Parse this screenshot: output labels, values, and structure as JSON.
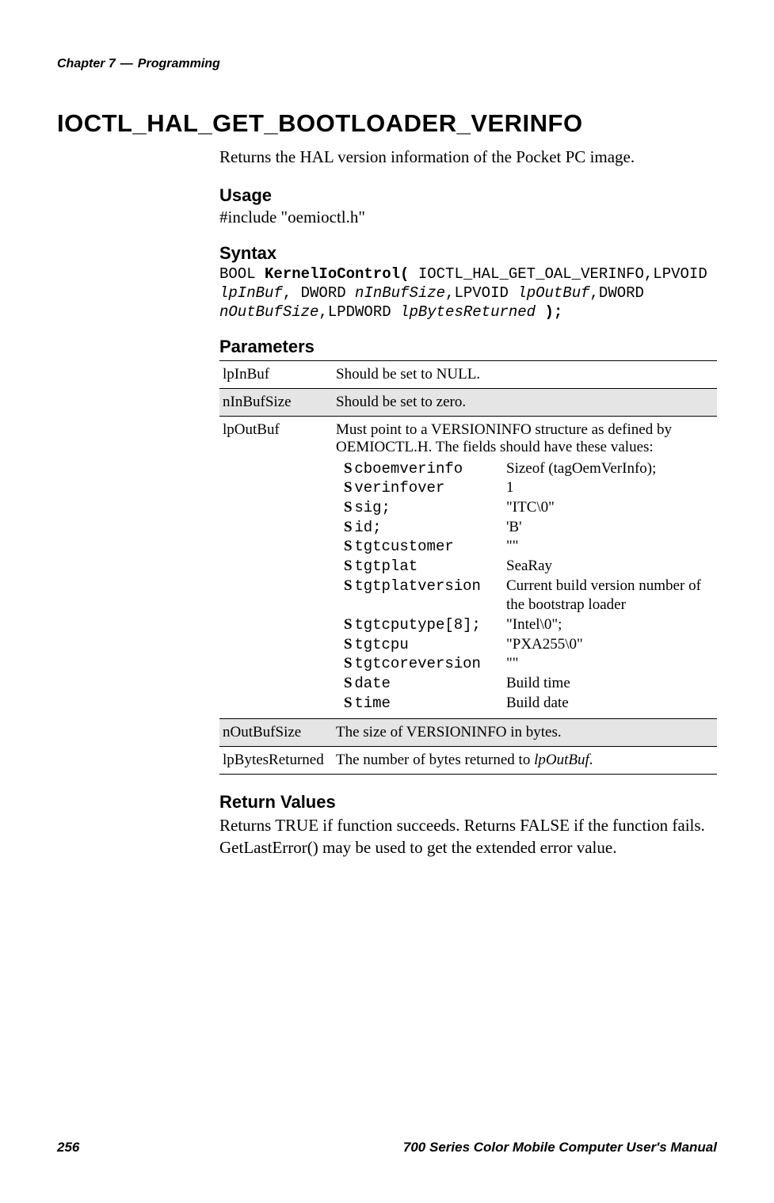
{
  "header": {
    "chapter": "Chapter 7",
    "dash": "—",
    "section": "Programming"
  },
  "title": "IOCTL_HAL_GET_BOOTLOADER_VERINFO",
  "intro": "Returns the HAL version information of the Pocket PC image.",
  "usage": {
    "heading": "Usage",
    "text": "#include \"oemioctl.h\""
  },
  "syntax": {
    "heading": "Syntax",
    "line1_pre": "BOOL ",
    "line1_kw": "KernelIoControl(",
    "line1_post": " IOCTL_HAL_GET_OAL_VERINFO,LPVOID",
    "line2_it1": "lpInBuf",
    "line2_mid1": ", DWORD ",
    "line2_it2": "nInBufSize",
    "line2_mid2": ",LPVOID ",
    "line2_it3": "lpOutBuf",
    "line2_mid3": ",DWORD",
    "line3_it1": "nOutBufSize",
    "line3_mid1": ",LPDWORD ",
    "line3_it2": "lpBytesReturned",
    "line3_end": " );"
  },
  "parameters": {
    "heading": "Parameters",
    "rows": [
      {
        "name": "lpInBuf",
        "desc": "Should be set to NULL."
      },
      {
        "name": "nInBufSize",
        "desc": "Should be set to zero."
      },
      {
        "name": "lpOutBuf",
        "desc_pre": "Must point to a VERSIONINFO structure as defined by OEMIOCTL.H. The fields should have these values:",
        "struct": [
          {
            "key": "cboemverinfo",
            "val": "Sizeof (tagOemVerInfo);"
          },
          {
            "key": "verinfover",
            "val": "1"
          },
          {
            "key": "sig;",
            "val": "\"ITC\\0\""
          },
          {
            "key": "id;",
            "val": "'B'"
          },
          {
            "key": "tgtcustomer",
            "val": "\"\""
          },
          {
            "key": "tgtplat",
            "val": "SeaRay"
          },
          {
            "key": "tgtplatversion",
            "val": "Current build version number of the bootstrap loader"
          },
          {
            "key": "tgtcputype[8];",
            "val": "\"Intel\\0\";"
          },
          {
            "key": "tgtcpu",
            "val": "\"PXA255\\0\""
          },
          {
            "key": "tgtcoreversion",
            "val": "\"\""
          },
          {
            "key": "date",
            "val": "Build time"
          },
          {
            "key": "time",
            "val": "Build date"
          }
        ]
      },
      {
        "name": "nOutBufSize",
        "desc": "The size of VERSIONINFO in bytes."
      },
      {
        "name": "lpBytesReturned",
        "desc_pre": "The number of bytes returned to ",
        "desc_it": "lpOutBuf",
        "desc_post": "."
      }
    ]
  },
  "return": {
    "heading": "Return Values",
    "text": "Returns TRUE if function succeeds. Returns FALSE if the function fails. GetLastError() may be used to get the extended error value."
  },
  "footer": {
    "page": "256",
    "manual": "700 Series Color Mobile Computer User's Manual"
  }
}
